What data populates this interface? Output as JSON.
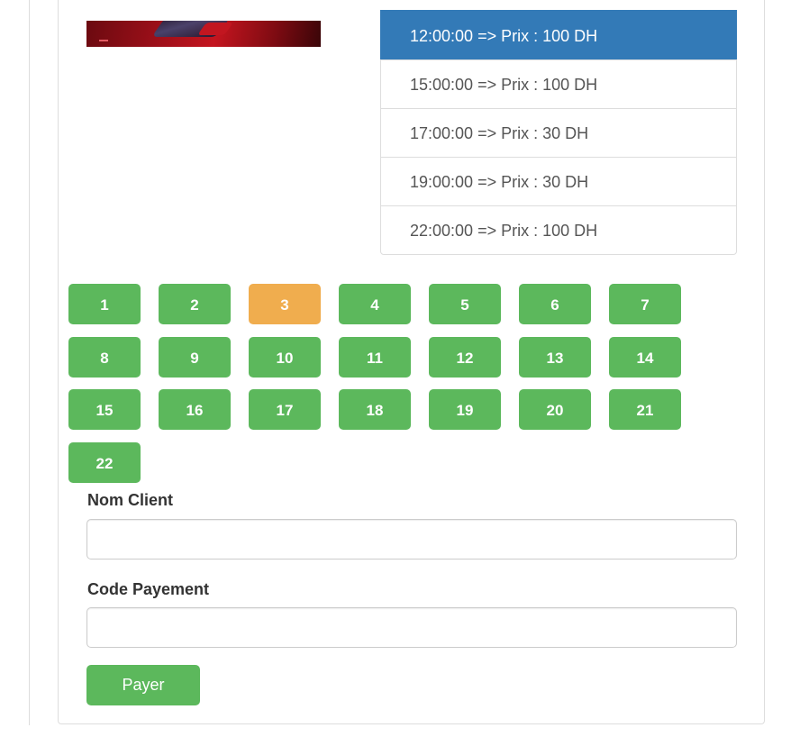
{
  "showtimes": [
    {
      "label": "12:00:00 => Prix : 100 DH",
      "active": true
    },
    {
      "label": "15:00:00 => Prix : 100 DH",
      "active": false
    },
    {
      "label": "17:00:00 => Prix : 30 DH",
      "active": false
    },
    {
      "label": "19:00:00 => Prix : 30 DH",
      "active": false
    },
    {
      "label": "22:00:00 => Prix : 100 DH",
      "active": false
    }
  ],
  "seats": [
    {
      "label": "1",
      "taken": false
    },
    {
      "label": "2",
      "taken": false
    },
    {
      "label": "3",
      "taken": true
    },
    {
      "label": "4",
      "taken": false
    },
    {
      "label": "5",
      "taken": false
    },
    {
      "label": "6",
      "taken": false
    },
    {
      "label": "7",
      "taken": false
    },
    {
      "label": "8",
      "taken": false
    },
    {
      "label": "9",
      "taken": false
    },
    {
      "label": "10",
      "taken": false
    },
    {
      "label": "11",
      "taken": false
    },
    {
      "label": "12",
      "taken": false
    },
    {
      "label": "13",
      "taken": false
    },
    {
      "label": "14",
      "taken": false
    },
    {
      "label": "15",
      "taken": false
    },
    {
      "label": "16",
      "taken": false
    },
    {
      "label": "17",
      "taken": false
    },
    {
      "label": "18",
      "taken": false
    },
    {
      "label": "19",
      "taken": false
    },
    {
      "label": "20",
      "taken": false
    },
    {
      "label": "21",
      "taken": false
    },
    {
      "label": "22",
      "taken": false
    }
  ],
  "form": {
    "client_label": "Nom Client",
    "client_value": "",
    "client_placeholder": "",
    "payment_label": "Code Payement",
    "payment_value": "",
    "payment_placeholder": "",
    "submit_label": "Payer"
  },
  "colors": {
    "seat_available": "#5cb85c",
    "seat_taken": "#f0ad4e",
    "showtime_active": "#337ab7"
  }
}
